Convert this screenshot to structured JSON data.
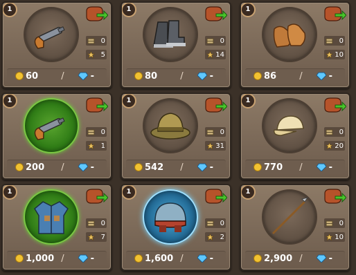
{
  "items": [
    {
      "level": "1",
      "stat_stock": "0",
      "stat_power": "5",
      "gold": "60",
      "gem": "-",
      "icon": "flintlock-pistol-icon",
      "glow": ""
    },
    {
      "level": "1",
      "stat_stock": "0",
      "stat_power": "14",
      "gold": "80",
      "gem": "-",
      "icon": "boots-icon",
      "glow": ""
    },
    {
      "level": "1",
      "stat_stock": "0",
      "stat_power": "10",
      "gold": "86",
      "gem": "-",
      "icon": "gloves-icon",
      "glow": ""
    },
    {
      "level": "1",
      "stat_stock": "0",
      "stat_power": "1",
      "gold": "200",
      "gem": "-",
      "icon": "flintlock-pistol-icon",
      "glow": "green"
    },
    {
      "level": "1",
      "stat_stock": "0",
      "stat_power": "31",
      "gold": "542",
      "gem": "-",
      "icon": "pith-helmet-icon",
      "glow": ""
    },
    {
      "level": "1",
      "stat_stock": "0",
      "stat_power": "20",
      "gold": "770",
      "gem": "-",
      "icon": "cap-icon",
      "glow": ""
    },
    {
      "level": "1",
      "stat_stock": "0",
      "stat_power": "7",
      "gold": "1,000",
      "gem": "-",
      "icon": "jacket-icon",
      "glow": "green"
    },
    {
      "level": "1",
      "stat_stock": "0",
      "stat_power": "2",
      "gold": "1,600",
      "gem": "-",
      "icon": "helmet-icon",
      "glow": "blue"
    },
    {
      "level": "1",
      "stat_stock": "0",
      "stat_power": "10",
      "gold": "2,900",
      "gem": "-",
      "icon": "spear-icon",
      "glow": ""
    }
  ],
  "colors": {
    "gold": "#f1c232",
    "gem": "#5ec8ff",
    "panel": "#7b6958"
  }
}
